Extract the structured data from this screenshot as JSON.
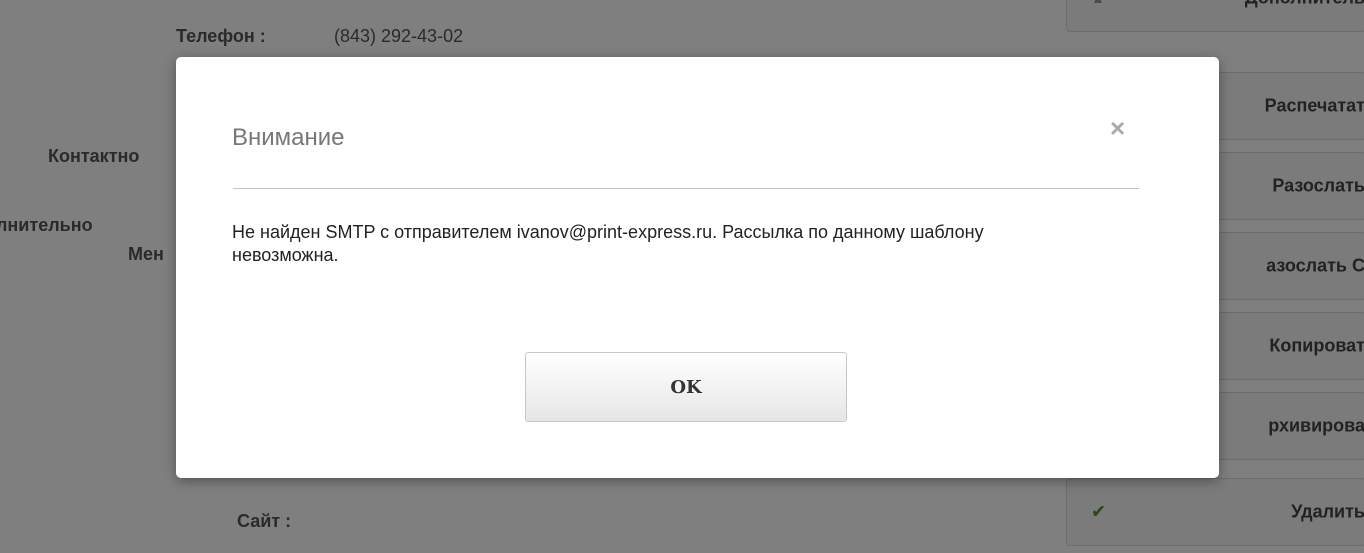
{
  "background": {
    "phone_label": "Телефон :",
    "phone_value": "(843) 292-43-02",
    "contact_label": "Контактно",
    "extra_label": "лнительно",
    "manager_label": "Мен",
    "site_label": "Сайт :",
    "actions": [
      {
        "label": "Дополнитель",
        "icon": "▲"
      },
      {
        "label": "Распечатат",
        "icon": ""
      },
      {
        "label": "Разослать",
        "icon": ""
      },
      {
        "label": "азослать С",
        "icon": ""
      },
      {
        "label": "Копироват",
        "icon": ""
      },
      {
        "label": "рхивирова",
        "icon": ""
      },
      {
        "label": "Удалить",
        "icon": "✔"
      }
    ]
  },
  "dialog": {
    "title": "Внимание",
    "close_symbol": "×",
    "message": "Не найден SMTP с отправителем ivanov@print-express.ru. Рассылка по данному шаблону невозможна.",
    "ok_label": "OK"
  }
}
